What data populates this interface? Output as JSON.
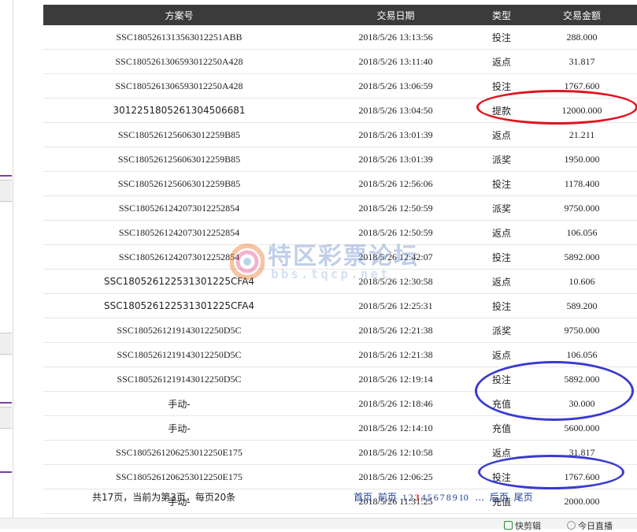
{
  "table": {
    "headers": {
      "plan_no": "方案号",
      "date": "交易日期",
      "type": "类型",
      "amount": "交易金额"
    },
    "rows": [
      {
        "plan_no": "SSC1805261313563012251ABB",
        "date": "2018/5/26 13:13:56",
        "type": "投注",
        "amount": "288.000"
      },
      {
        "plan_no": "SSC1805261306593012250A428",
        "date": "2018/5/26 13:11:40",
        "type": "返点",
        "amount": "31.817"
      },
      {
        "plan_no": "SSC1805261306593012250A428",
        "date": "2018/5/26 13:06:59",
        "type": "投注",
        "amount": "1767.600"
      },
      {
        "plan_no": "301225180526130450668​1",
        "date": "2018/5/26 13:04:50",
        "type": "提款",
        "amount": "12000.000"
      },
      {
        "plan_no": "SSC1805261256063012259B85",
        "date": "2018/5/26 13:01:39",
        "type": "返点",
        "amount": "21.211"
      },
      {
        "plan_no": "SSC1805261256063012259B85",
        "date": "2018/5/26 13:01:39",
        "type": "派奖",
        "amount": "1950.000"
      },
      {
        "plan_no": "SSC1805261256063012259B85",
        "date": "2018/5/26 12:56:06",
        "type": "投注",
        "amount": "1178.400"
      },
      {
        "plan_no": "SSC1805261242073012252854",
        "date": "2018/5/26 12:50:59",
        "type": "派奖",
        "amount": "9750.000"
      },
      {
        "plan_no": "SSC1805261242073012252854",
        "date": "2018/5/26 12:50:59",
        "type": "返点",
        "amount": "106.056"
      },
      {
        "plan_no": "SSC1805261242073012252854",
        "date": "2018/5/26 12:42:07",
        "type": "投注",
        "amount": "5892.000"
      },
      {
        "plan_no": "SSC18052612253130​1225CFA4",
        "date": "2018/5/26 12:30:58",
        "type": "返点",
        "amount": "10.606"
      },
      {
        "plan_no": "SSC18052612253130​1225CFA4",
        "date": "2018/5/26 12:25:31",
        "type": "投注",
        "amount": "589.200"
      },
      {
        "plan_no": "SSC1805261219143012250D5C",
        "date": "2018/5/26 12:21:38",
        "type": "派奖",
        "amount": "9750.000"
      },
      {
        "plan_no": "SSC1805261219143012250D5C",
        "date": "2018/5/26 12:21:38",
        "type": "返点",
        "amount": "106.056"
      },
      {
        "plan_no": "SSC1805261219143012250D5C",
        "date": "2018/5/26 12:19:14",
        "type": "投注",
        "amount": "5892.000"
      },
      {
        "plan_no": "手动-",
        "date": "2018/5/26 12:18:46",
        "type": "充值",
        "amount": "30.000"
      },
      {
        "plan_no": "手动-",
        "date": "2018/5/26 12:14:10",
        "type": "充值",
        "amount": "5600.000"
      },
      {
        "plan_no": "SSC1805261206253012250E175",
        "date": "2018/5/26 12:10:58",
        "type": "返点",
        "amount": "31.817"
      },
      {
        "plan_no": "SSC1805261206253012250E175",
        "date": "2018/5/26 12:06:25",
        "type": "投注",
        "amount": "1767.600"
      },
      {
        "plan_no": "手动-",
        "date": "2018/5/26 11:31:25",
        "type": "充值",
        "amount": "2000.000"
      }
    ]
  },
  "footer": {
    "summary": "共17页，当前为第3页，每页20条"
  },
  "pager": {
    "first": "首页",
    "prev": "前页",
    "pages": [
      "1",
      "2",
      "3",
      "4",
      "5",
      "6",
      "7",
      "8",
      "9",
      "10"
    ],
    "current_page": "3",
    "ellipsis": "...",
    "next": "后页",
    "last": "尾页"
  },
  "bottom_bar": {
    "item1": "快剪辑",
    "item2": "今日直播"
  },
  "watermark": {
    "title": "特区彩票论坛",
    "subtitle": "bbs.tqcp.net"
  },
  "colors": {
    "header_bg": "#3b3b3b",
    "link": "#1e3f9a",
    "current_page": "#d42020",
    "annotation_red": "#e0141e",
    "annotation_blue": "#3a3ad0"
  }
}
